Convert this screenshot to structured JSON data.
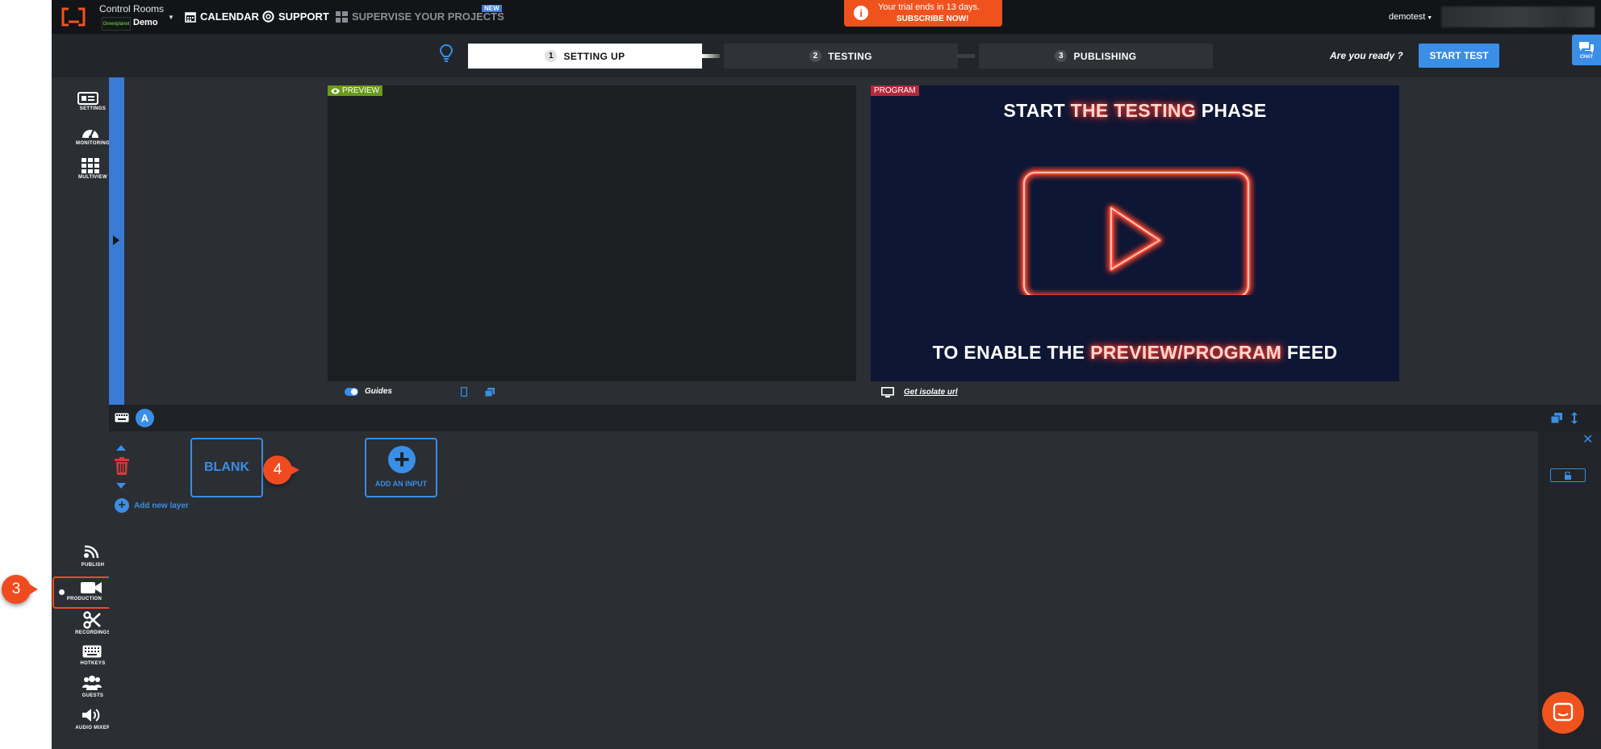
{
  "app": {
    "workspace_title": "Control Rooms",
    "org_logo_text": "Greenplanet",
    "room_name": "Demo",
    "nav": {
      "calendar": "CALENDAR",
      "support": "SUPPORT",
      "supervise": "SUPERVISE YOUR PROJECTS",
      "new_badge": "NEW"
    },
    "trial": {
      "line1": "Your trial ends in 13 days.",
      "line2": "SUBSCRIBE NOW!"
    },
    "user": "demotest"
  },
  "steps": [
    {
      "num": "1",
      "label": "SETTING UP"
    },
    {
      "num": "2",
      "label": "TESTING"
    },
    {
      "num": "3",
      "label": "PUBLISHING"
    }
  ],
  "ready": {
    "question": "Are you ready ?",
    "button": "START TEST"
  },
  "chat_label": "CHAT",
  "left_nav_top": [
    {
      "label": "SETTINGS",
      "icon": "settings-icon"
    },
    {
      "label": "MONITORING",
      "icon": "gauge-icon"
    },
    {
      "label": "MULTIVIEW",
      "icon": "grid-icon"
    }
  ],
  "left_nav_bottom": [
    {
      "label": "PUBLISH",
      "icon": "broadcast-icon"
    },
    {
      "label": "PRODUCTION",
      "icon": "video-camera-icon"
    },
    {
      "label": "RECORDINGS",
      "icon": "scissors-icon"
    },
    {
      "label": "HOTKEYS",
      "icon": "keyboard-icon"
    },
    {
      "label": "GUESTS",
      "icon": "users-icon"
    },
    {
      "label": "AUDIO MIXER",
      "icon": "speaker-icon"
    }
  ],
  "preview": {
    "tag": "PREVIEW",
    "guides_label": "Guides"
  },
  "program": {
    "tag": "PROGRAM",
    "headline_pre": "START ",
    "headline_hl": "THE TESTING",
    "headline_post": " PHASE",
    "footer_pre": "TO ENABLE THE ",
    "footer_hl": "PREVIEW/PROGRAM",
    "footer_post": " FEED",
    "isolate_label": "Get isolate url"
  },
  "layers": {
    "scene_letter": "A",
    "blank_label": "BLANK",
    "add_layer": "Add new layer",
    "add_input": "ADD AN INPUT"
  },
  "callouts": {
    "production": "3",
    "add_input": "4"
  },
  "colors": {
    "accent": "#3a8ee6",
    "trial_orange": "#f0521e",
    "callout": "#ef4b1f",
    "preview_tag": "#6a9a1a",
    "program_tag": "#b3283a",
    "neon": "#ff4a33"
  }
}
